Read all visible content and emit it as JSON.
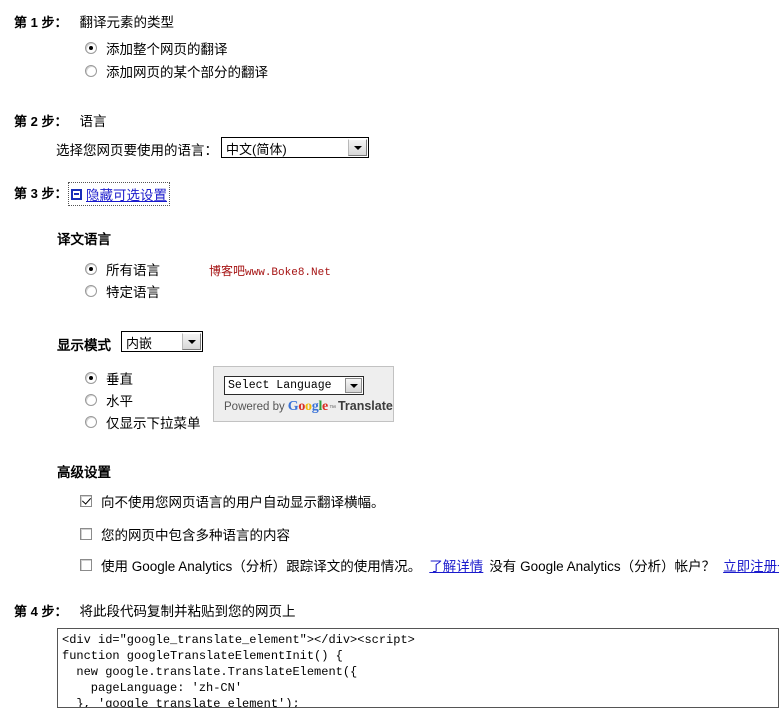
{
  "steps": [
    {
      "num": "第 1 步：",
      "title": "翻译元素的类型"
    },
    {
      "num": "第 2 步：",
      "title": "语言"
    },
    {
      "num": "第 3 步：",
      "title": ""
    },
    {
      "num": "第 4 步：",
      "title": "将此段代码复制并粘贴到您的网页上"
    }
  ],
  "step1": {
    "options": [
      {
        "label": "添加整个网页的翻译",
        "checked": true
      },
      {
        "label": "添加网页的某个部分的翻译",
        "checked": false
      }
    ]
  },
  "step2": {
    "prompt": "选择您网页要使用的语言：",
    "language_select": {
      "value": "中文(简体)"
    }
  },
  "step3": {
    "toggle_link": "隐藏可选设置",
    "translation_language": {
      "heading": "译文语言",
      "options": [
        {
          "label": "所有语言",
          "checked": true
        },
        {
          "label": "特定语言",
          "checked": false
        }
      ]
    },
    "display_mode": {
      "heading": "显示模式",
      "select": {
        "value": "内嵌"
      },
      "options": [
        {
          "label": "垂直",
          "checked": true
        },
        {
          "label": "水平",
          "checked": false
        },
        {
          "label": "仅显示下拉菜单",
          "checked": false
        }
      ]
    },
    "widget_preview": {
      "select_value": "Select Language",
      "powered_by": "Powered by",
      "brand_g": "G",
      "brand_o1": "o",
      "brand_o2": "o",
      "brand_g2": "g",
      "brand_l": "l",
      "brand_e": "e",
      "brand_tm": "™",
      "brand_translate": "Translate"
    },
    "advanced": {
      "heading": "高级设置",
      "options": [
        {
          "label": "向不使用您网页语言的用户自动显示翻译横幅。",
          "checked": true
        },
        {
          "label": "您的网页中包含多种语言的内容",
          "checked": false
        }
      ],
      "analytics": {
        "checked": false,
        "text_before": "使用 Google Analytics（分析）跟踪译文的使用情况。",
        "link_learn_more": "了解详情",
        "text_middle": "没有 Google Analytics（分析）帐户？",
        "link_signup": "立即注册一个"
      }
    }
  },
  "step4": {
    "code": "<div id=\"google_translate_element\"></div><script>\nfunction googleTranslateElementInit() {\n  new google.translate.TranslateElement({\n    pageLanguage: 'zh-CN'\n  }, 'google_translate_element');"
  },
  "watermark": {
    "cn": "博客吧",
    "url": "www.Boke8.Net",
    "color": "#a61414"
  }
}
